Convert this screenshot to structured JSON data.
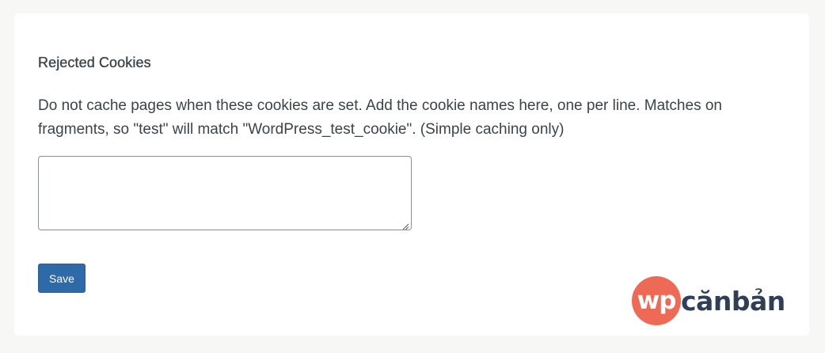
{
  "section": {
    "title": "Rejected Cookies",
    "description": "Do not cache pages when these cookies are set. Add the cookie names here, one per line. Matches on fragments, so \"test\" will match \"WordPress_test_cookie\". (Simple caching only)"
  },
  "cookies_field": {
    "value": ""
  },
  "actions": {
    "save_label": "Save"
  },
  "watermark": {
    "badge_text": "wp",
    "text": "cănbản"
  },
  "colors": {
    "page_background": "#f7f7f5",
    "card_background": "#ffffff",
    "button_primary": "#2f6aa8",
    "logo_badge": "#ee6a55",
    "logo_text": "#2f3f55"
  }
}
